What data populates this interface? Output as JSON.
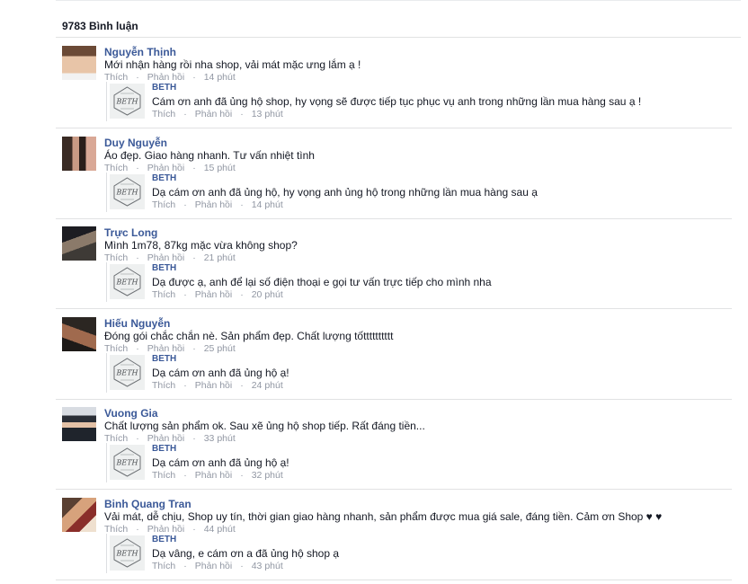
{
  "comments_header": {
    "count_label": "9783 Bình luận"
  },
  "actions": {
    "like": "Thích",
    "reply": "Phản hồi",
    "sep": "·"
  },
  "threads": [
    {
      "author": "Nguyễn Thịnh",
      "text": "Mới nhận hàng rồi nha shop, vải mát mặc ưng lắm ạ !",
      "time": "14 phút",
      "reply": {
        "author": "BETH",
        "text": "Cám ơn anh đã ủng hộ shop, hy vọng sẽ được tiếp tục phục vụ anh trong những lần mua hàng sau ạ !",
        "time": "13 phút"
      }
    },
    {
      "author": "Duy Nguyễn",
      "text": "Áo đẹp. Giao hàng nhanh. Tư vấn nhiệt tình",
      "time": "15 phút",
      "reply": {
        "author": "BETH",
        "text": "Dạ cám ơn anh đã ủng hộ, hy vọng anh ủng hộ trong những lần mua hàng sau ạ",
        "time": "14 phút"
      }
    },
    {
      "author": "Trực Long",
      "text": "Mình 1m78, 87kg mặc vừa không shop?",
      "time": "21 phút",
      "reply": {
        "author": "BETH",
        "text": "Dạ được ạ, anh để lại số điện thoại e gọi tư vấn trực tiếp cho mình nha",
        "time": "20 phút"
      }
    },
    {
      "author": "Hiếu Nguyễn",
      "text": "Đóng gói chắc chắn nè. Sản phẩm đẹp. Chất lượng tốtttttttttt",
      "time": "25 phút",
      "reply": {
        "author": "BETH",
        "text": "Dạ cám ơn anh đã ủng hộ ạ!",
        "time": "24 phút"
      }
    },
    {
      "author": "Vuong Gia",
      "text": "Chất lượng sản phẩm ok. Sau xẽ ủng hộ shop tiếp. Rất đáng tiền...",
      "time": "33 phút",
      "reply": {
        "author": "BETH",
        "text": "Dạ cám ơn anh đã ủng hộ ạ!",
        "time": "32 phút"
      }
    },
    {
      "author": "Binh Quang Tran",
      "text": "Vải mát, dễ chịu, Shop uy tín, thời gian giao hàng nhanh, sản phẩm được mua giá sale, đáng tiền. Cảm ơn Shop ♥ ♥",
      "time": "44 phút",
      "reply": {
        "author": "BETH",
        "text": "Dạ vâng, e cám ơn a đã ủng hộ shop ạ",
        "time": "43 phút"
      }
    }
  ],
  "colors": {
    "author": "#3b5998",
    "meta": "#9197a3",
    "divider": "#e1e2e3"
  }
}
